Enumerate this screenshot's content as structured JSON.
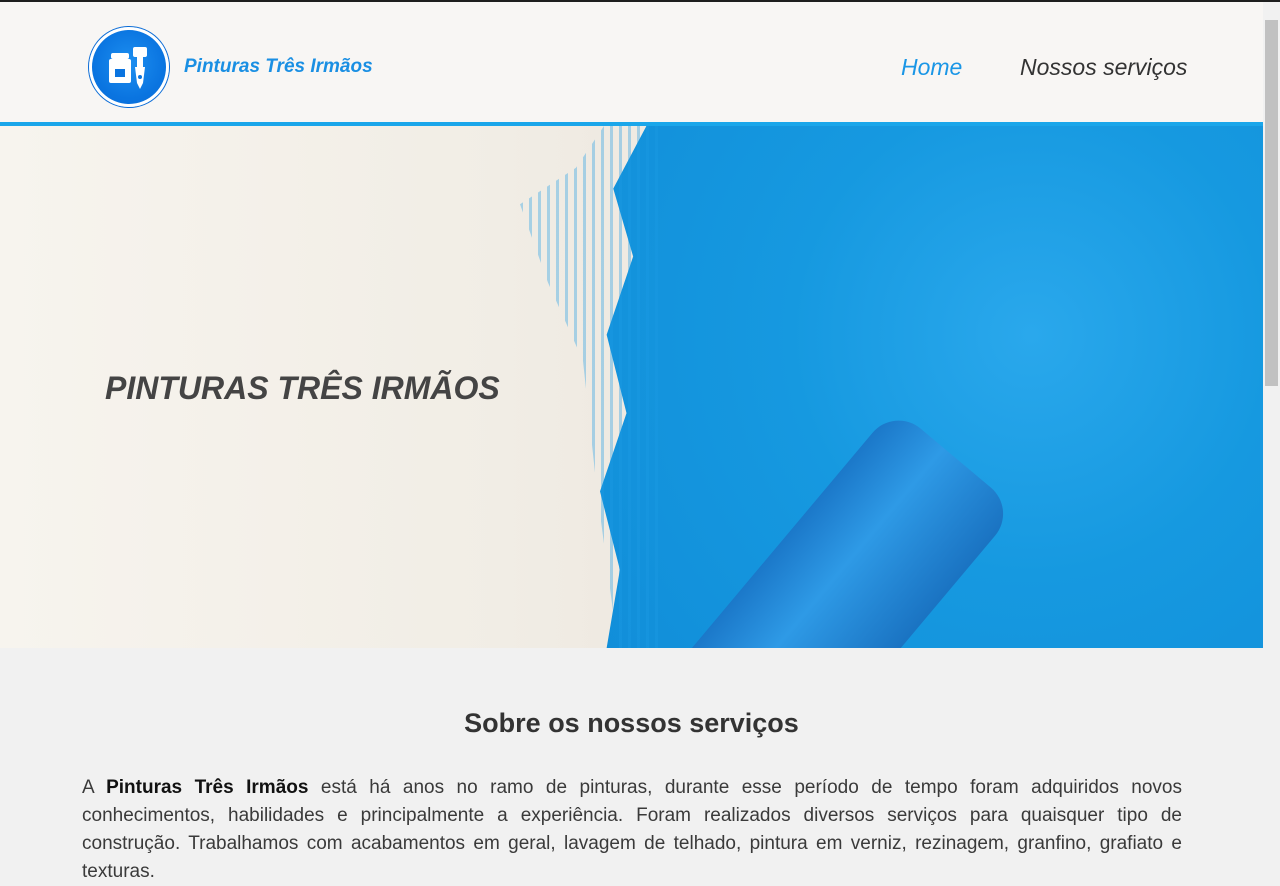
{
  "header": {
    "brand": "Pinturas Três Irmãos",
    "nav": {
      "home": "Home",
      "services": "Nossos serviços"
    }
  },
  "hero": {
    "title": "PINTURAS TRÊS IRMÃOS"
  },
  "about": {
    "title": "Sobre os nossos serviços",
    "lead": "A ",
    "brand_bold": "Pinturas Três Irmãos",
    "text": " está há anos no ramo de pinturas, durante esse período de tempo foram adquiridos novos conhecimentos, habilidades e principalmente a experiência. Foram realizados diversos serviços para quaisquer tipo de construção. Trabalhamos com acabamentos em geral, lavagem de telhado, pintura em verniz, rezinagem, granfino, grafiato e texturas."
  },
  "colors": {
    "accent": "#1aa6ea",
    "brand": "#1a8fe3"
  },
  "icons": [
    "paint-bucket-brush-icon"
  ]
}
